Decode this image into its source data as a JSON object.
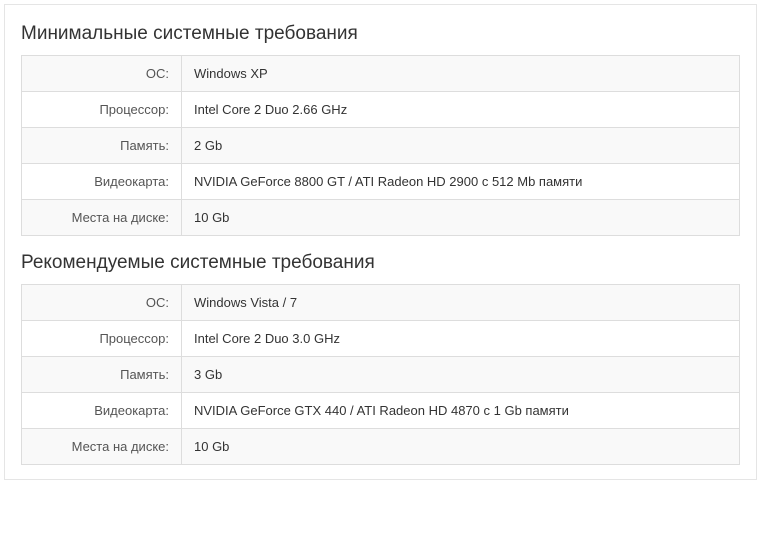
{
  "sections": [
    {
      "title": "Минимальные системные требования",
      "rows": [
        {
          "label": "ОС:",
          "value": "Windows XP"
        },
        {
          "label": "Процессор:",
          "value": "Intel Core 2 Duo 2.66 GHz"
        },
        {
          "label": "Память:",
          "value": "2 Gb"
        },
        {
          "label": "Видеокарта:",
          "value": "NVIDIA GeForce 8800 GT / ATI Radeon HD 2900 с 512 Mb памяти"
        },
        {
          "label": "Места на диске:",
          "value": "10 Gb"
        }
      ]
    },
    {
      "title": "Рекомендуемые системные требования",
      "rows": [
        {
          "label": "ОС:",
          "value": "Windows Vista / 7"
        },
        {
          "label": "Процессор:",
          "value": "Intel Core 2 Duo 3.0 GHz"
        },
        {
          "label": "Память:",
          "value": "3 Gb"
        },
        {
          "label": "Видеокарта:",
          "value": "NVIDIA GeForce GTX 440 / ATI Radeon HD 4870 с 1 Gb памяти"
        },
        {
          "label": "Места на диске:",
          "value": "10 Gb"
        }
      ]
    }
  ]
}
